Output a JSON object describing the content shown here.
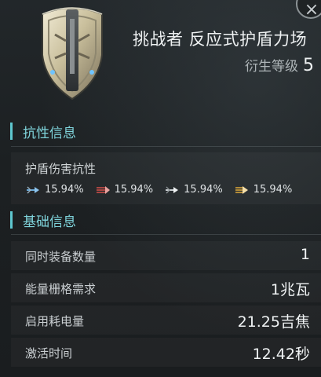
{
  "header": {
    "title": "挑战者 反应式护盾力场",
    "level_label": "衍生等级",
    "level_value": "5",
    "close_symbol": "×"
  },
  "icons": {
    "item": "shield-icon",
    "close": "close-icon",
    "resistance": [
      "em-damage-icon",
      "thermal-damage-icon",
      "kinetic-damage-icon",
      "explosive-damage-icon"
    ]
  },
  "colors": {
    "accent": "#5ec7cf",
    "em": "#6aa9d8",
    "thermal": "#d6504a",
    "kinetic": "#c9ced1",
    "explosive": "#e0a93a"
  },
  "resistance_section": {
    "title": "抗性信息",
    "subtitle": "护盾伤害抗性",
    "values": [
      "15.94%",
      "15.94%",
      "15.94%",
      "15.94%"
    ]
  },
  "basic_section": {
    "title": "基础信息",
    "rows": [
      {
        "label": "同时装备数量",
        "value": "1"
      },
      {
        "label": "能量栅格需求",
        "value": "1兆瓦"
      },
      {
        "label": "启用耗电量",
        "value": "21.25吉焦"
      },
      {
        "label": "激活时间",
        "value": "12.42秒"
      }
    ]
  }
}
